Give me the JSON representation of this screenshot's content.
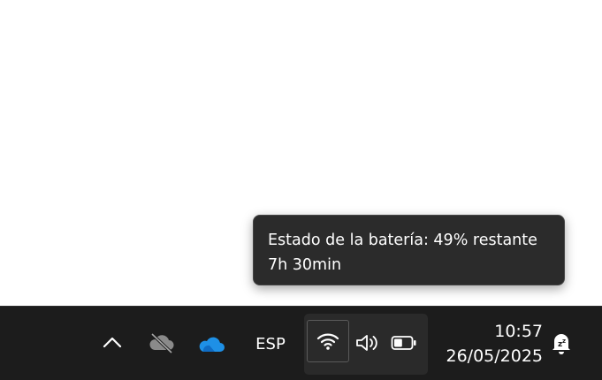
{
  "tooltip": {
    "line1": "Estado de la batería: 49% restante",
    "line2": "7h 30min"
  },
  "taskbar": {
    "language": "ESP",
    "time": "10:57",
    "date": "26/05/2025",
    "battery_percent": 49,
    "icons": {
      "overflow": "chevron-up-icon",
      "cloud_offline": "cloud-off-icon",
      "onedrive": "onedrive-cloud-icon",
      "wifi": "wifi-icon",
      "volume": "volume-icon",
      "battery": "battery-icon",
      "notifications": "notification-bell-snooze-icon"
    },
    "colors": {
      "onedrive_blue": "#1e90e6",
      "taskbar_bg": "#1c1c1c",
      "tooltip_bg": "#2b2b2b"
    }
  }
}
